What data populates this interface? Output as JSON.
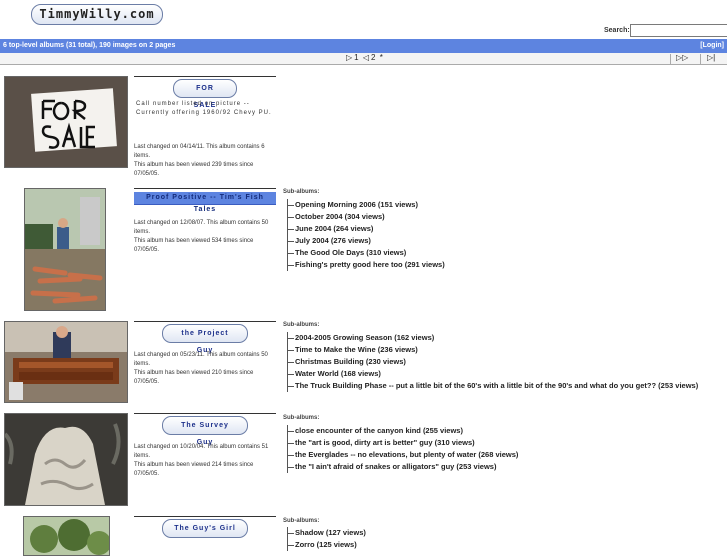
{
  "site": {
    "logo": "TimmyWilly.com"
  },
  "search": {
    "label": "Search:",
    "value": ""
  },
  "infobar": {
    "summary": "6 top-level albums (31 total), 190 images on 2 pages",
    "login": "[Login]"
  },
  "nav": {
    "prev": "▷",
    "page1": "1",
    "prev2": "◁",
    "page2": "2",
    "current": "*",
    "next": "▷▷",
    "last": "▷|"
  },
  "colors": {
    "accent": "#5d84e0",
    "title_text": "#1b2f8a"
  },
  "albums": [
    {
      "title": "FOR SALE",
      "description": "Call number listed on picture -- Currently offering 1960/92 Chevy PU.",
      "changed": "Last changed on 04/14/11. This album contains 6 items.",
      "views": "This album has been viewed 239 times since 07/05/05."
    },
    {
      "title": "Proof Positive -- Tim's Fish Tales",
      "changed": "Last changed on 12/08/07. This album contains 50 items.",
      "views": "This album has been viewed 534 times since 07/05/05.",
      "sub_label": "Sub-albums:",
      "subs": [
        "Opening Morning 2006 (151 views)",
        "October 2004 (304 views)",
        "June 2004 (264 views)",
        "July 2004 (276 views)",
        "The Good Ole Days (310 views)",
        "Fishing's pretty good here too (291 views)"
      ]
    },
    {
      "title": "the Project Guy",
      "changed": "Last changed on 05/23/11. This album contains 50 items.",
      "views": "This album has been viewed 210 times since 07/05/05.",
      "sub_label": "Sub-albums:",
      "subs": [
        "2004-2005 Growing Season (162 views)",
        "Time to Make the Wine (236 views)",
        "Christmas Building (230 views)",
        "Water World (168 views)",
        "The Truck Building Phase -- put a little bit of the 60's with a little bit of the 90's and what do you get?? (253 views)"
      ]
    },
    {
      "title": "The Survey Guy",
      "changed": "Last changed on 10/20/04. This album contains 51 items.",
      "views": "This album has been viewed 214 times since 07/05/05.",
      "sub_label": "Sub-albums:",
      "subs": [
        "close encounter of the canyon kind (255 views)",
        "the \"art is good, dirty art is better\" guy (310 views)",
        "the Everglades -- no elevations, but plenty of water (268 views)",
        "the \"I ain't afraid of snakes or alligators\" guy (253 views)"
      ]
    },
    {
      "title": "The Guy's Girl",
      "sub_label": "Sub-albums:",
      "subs": [
        "Shadow (127 views)",
        "Zorro (125 views)"
      ]
    }
  ]
}
